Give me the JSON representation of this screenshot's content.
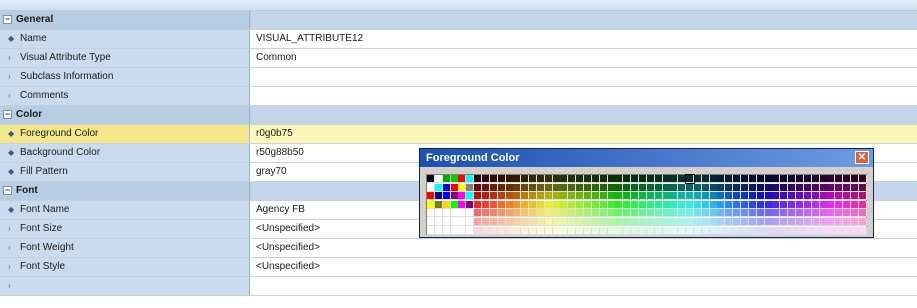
{
  "grid": {
    "rows": [
      {
        "kind": "cat",
        "toggle": "−",
        "label": "General",
        "value": ""
      },
      {
        "kind": "prop",
        "marker": "◆",
        "label": "Name",
        "value": "VISUAL_ATTRIBUTE12"
      },
      {
        "kind": "prop",
        "marker": "›",
        "label": "Visual Attribute Type",
        "value": "Common"
      },
      {
        "kind": "prop",
        "marker": "›",
        "label": "Subclass Information",
        "value": ""
      },
      {
        "kind": "prop",
        "marker": "›",
        "label": "Comments",
        "value": ""
      },
      {
        "kind": "cat",
        "toggle": "−",
        "label": "Color",
        "value": ""
      },
      {
        "kind": "sel",
        "marker": "◆",
        "label": "Foreground Color",
        "value": "r0g0b75"
      },
      {
        "kind": "prop",
        "marker": "◆",
        "label": "Background Color",
        "value": "r50g88b50"
      },
      {
        "kind": "prop",
        "marker": "◆",
        "label": "Fill Pattern",
        "value": "gray70"
      },
      {
        "kind": "cat",
        "toggle": "−",
        "label": "Font",
        "value": ""
      },
      {
        "kind": "prop",
        "marker": "◆",
        "label": "Font Name",
        "value": "Agency FB"
      },
      {
        "kind": "prop",
        "marker": "›",
        "label": "Font Size",
        "value": "<Unspecified>"
      },
      {
        "kind": "prop",
        "marker": "›",
        "label": "Font Weight",
        "value": "<Unspecified>"
      },
      {
        "kind": "prop",
        "marker": "›",
        "label": "Font Style",
        "value": "<Unspecified>"
      },
      {
        "kind": "prop",
        "marker": "›",
        "label": "",
        "value": ""
      }
    ]
  },
  "palette": {
    "title": "Foreground Color",
    "close_glyph": "✕",
    "columns": 56,
    "rows": 7,
    "selected_index": 33,
    "colors": {
      "accent_title": "#1c4fb0",
      "selection_row": "#fbf5b8",
      "category_row": "#b7cde4"
    }
  }
}
